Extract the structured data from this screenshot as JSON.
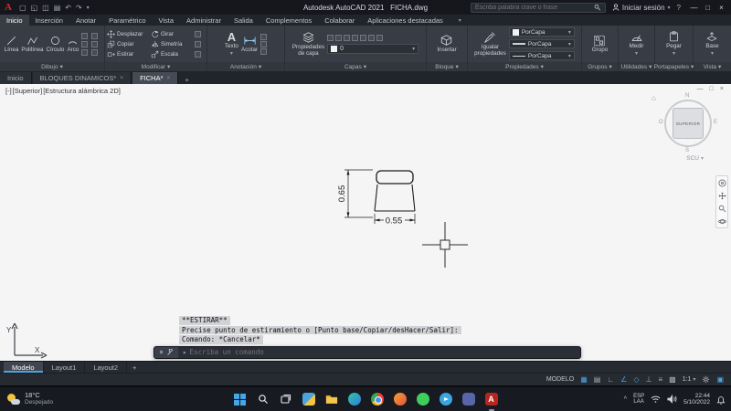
{
  "colors": {
    "accent_blue": "#4da3e0",
    "logo_red": "#d22b2b",
    "canvas_bg": "#f5f5f6",
    "autocad_app_red": "#b6251f"
  },
  "icons": {
    "caret_down": "▾",
    "close": "×",
    "minimize": "—",
    "restore": "□",
    "help": "?",
    "prompt_arrow": "▸",
    "chevron_up": "^",
    "home": "⌂",
    "plus": "+"
  },
  "titlebar": {
    "logo_letter": "A",
    "qat_icons": [
      "▢",
      "◱",
      "◫",
      "▤",
      "↶",
      "↷"
    ],
    "app_title": "Autodesk AutoCAD 2021",
    "doc_title": "FICHA.dwg",
    "search_placeholder": "Escriba palabra clave o frase",
    "signin_label": "Iniciar sesión"
  },
  "ribbon_tabs": {
    "items": [
      {
        "label": "Inicio"
      },
      {
        "label": "Inserción"
      },
      {
        "label": "Anotar"
      },
      {
        "label": "Paramétrico"
      },
      {
        "label": "Vista"
      },
      {
        "label": "Administrar"
      },
      {
        "label": "Salida"
      },
      {
        "label": "Complementos"
      },
      {
        "label": "Colaborar"
      },
      {
        "label": "Aplicaciones destacadas"
      }
    ]
  },
  "ribbon": {
    "dibujo": {
      "title": "Dibujo",
      "linea": "Línea",
      "polilinea": "Polilínea",
      "circulo": "Círculo",
      "arco": "Arco"
    },
    "modificar": {
      "title": "Modificar",
      "desplazar": "Desplazar",
      "girar": "Girar",
      "copiar": "Copiar",
      "simetria": "Simetría",
      "estirar": "Estirar",
      "escala": "Escala"
    },
    "anotacion": {
      "title": "Anotación",
      "texto": "Texto",
      "acotar": "Acotar"
    },
    "capas": {
      "title": "Capas",
      "propiedades_capa": "Propiedades\nde capa",
      "layer_actual": "0"
    },
    "bloque": {
      "title": "Bloque",
      "insertar": "Insertar"
    },
    "propiedades": {
      "title": "Propiedades",
      "igualar": "Igualar\npropiedades",
      "color": "PorCapa",
      "grosor": "PorCapa",
      "tipo": "PorCapa"
    },
    "grupos": {
      "title": "Grupos",
      "grupo": "Grupo"
    },
    "utilidades": {
      "title": "Utilidades",
      "medir": "Medir"
    },
    "portapapeles": {
      "title": "Portapapeles",
      "pegar": "Pegar"
    },
    "vista": {
      "title": "Vista",
      "base": "Base"
    }
  },
  "file_tabs": {
    "items": [
      {
        "label": "Inicio"
      },
      {
        "label": "BLOQUES DINAMICOS*"
      },
      {
        "label": "FICHA*"
      }
    ]
  },
  "viewport": {
    "controls": {
      "minimize": "[-]",
      "view": "[Superior]",
      "visual_style": "[Estructura alámbrica 2D]"
    },
    "viewcube": {
      "face": "SUPERIOR",
      "n": "N",
      "s": "S",
      "e": "E",
      "o": "O",
      "coord_label": "SCU"
    },
    "dims": {
      "vertical": "0.65",
      "horizontal": "0.55"
    },
    "ucs": {
      "x": "X",
      "y": "Y"
    }
  },
  "command": {
    "history": [
      {
        "text": "**ESTIRAR**"
      },
      {
        "text": "Precise punto de estiramiento o [Punto base/Copiar/desHacer/Salir]:"
      },
      {
        "text": "Comando: *Cancelar*"
      }
    ],
    "prompt_placeholder": "Escriba un comando"
  },
  "layout_tabs": {
    "items": [
      {
        "label": "Modelo"
      },
      {
        "label": "Layout1"
      },
      {
        "label": "Layout2"
      }
    ]
  },
  "statusbar": {
    "modelo_label": "MODELO",
    "scale": "1:1",
    "icons": [
      {
        "name": "grid",
        "glyph": "▦",
        "on": true
      },
      {
        "name": "snap",
        "glyph": "▤",
        "on": false
      },
      {
        "name": "ortho",
        "glyph": "∟",
        "on": false
      },
      {
        "name": "polar",
        "glyph": "∠",
        "on": true
      },
      {
        "name": "osnap",
        "glyph": "◇",
        "on": true
      },
      {
        "name": "otrack",
        "glyph": "⊥",
        "on": false
      },
      {
        "name": "lineweight",
        "glyph": "≡",
        "on": false
      },
      {
        "name": "transparency",
        "glyph": "▩",
        "on": false
      },
      {
        "name": "clean-screen",
        "glyph": "▣",
        "on": true
      }
    ]
  },
  "taskbar": {
    "weather": {
      "temp": "18°C",
      "desc": "Despejado"
    },
    "autocad_letter": "A",
    "tray": {
      "lang_primary": "ESP",
      "lang_secondary": "LAA",
      "time": "22:44",
      "date": "5/10/2022"
    }
  }
}
